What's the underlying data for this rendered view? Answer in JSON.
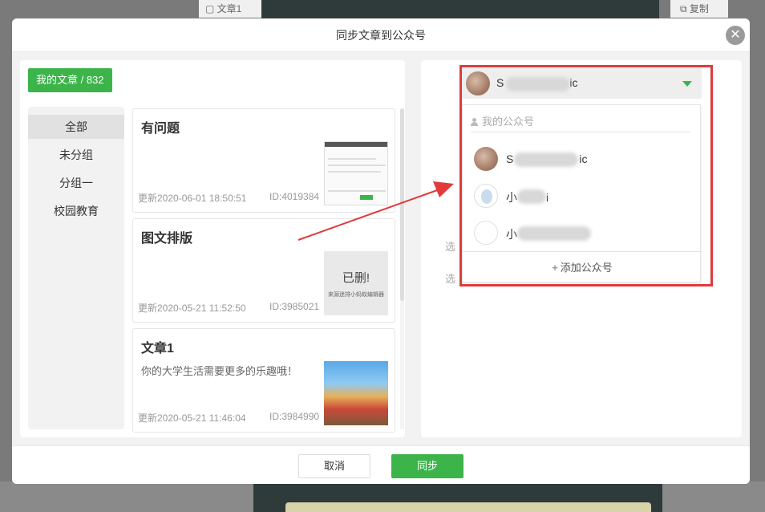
{
  "background": {
    "tab_left": "文章1",
    "tab_right": "复制"
  },
  "modal": {
    "title": "同步文章到公众号",
    "close_symbol": "✕",
    "cancel_label": "取消",
    "sync_label": "同步"
  },
  "left": {
    "my_articles_label": "我的文章 / 832",
    "groups": [
      {
        "label": "全部",
        "active": true
      },
      {
        "label": "未分组",
        "active": false
      },
      {
        "label": "分组一",
        "active": false
      },
      {
        "label": "校园教育",
        "active": false
      }
    ],
    "articles": [
      {
        "title": "有问题",
        "desc": "",
        "date": "更新2020-06-01 18:50:51",
        "id": "ID:4019384",
        "thumb": "screenshot"
      },
      {
        "title": "图文排版",
        "desc": "",
        "date": "更新2020-05-21 11:52:50",
        "id": "ID:3985021",
        "thumb": "deleted",
        "thumb_big": "已删!",
        "thumb_small": "来源迷排小蚂蚁编辑器"
      },
      {
        "title": "文章1",
        "desc": "你的大学生活需要更多的乐趣哦！",
        "date": "更新2020-05-21 11:46:04",
        "id": "ID:3984990",
        "thumb": "photo"
      }
    ]
  },
  "right": {
    "ghost_labels": [
      "选",
      "选"
    ],
    "selected_account_prefix": "S",
    "selected_account_suffix": "ic",
    "menu_header": "我的公众号",
    "accounts": [
      {
        "prefix": "S",
        "suffix": "ic",
        "avatar": "photo"
      },
      {
        "prefix": "小",
        "suffix": "i",
        "avatar": "blue"
      },
      {
        "prefix": "小",
        "suffix": "",
        "avatar": "white"
      }
    ],
    "add_account_label": "添加公众号",
    "add_symbol": "+"
  },
  "colors": {
    "accent": "#3cb44a",
    "highlight": "#e03a3a"
  }
}
